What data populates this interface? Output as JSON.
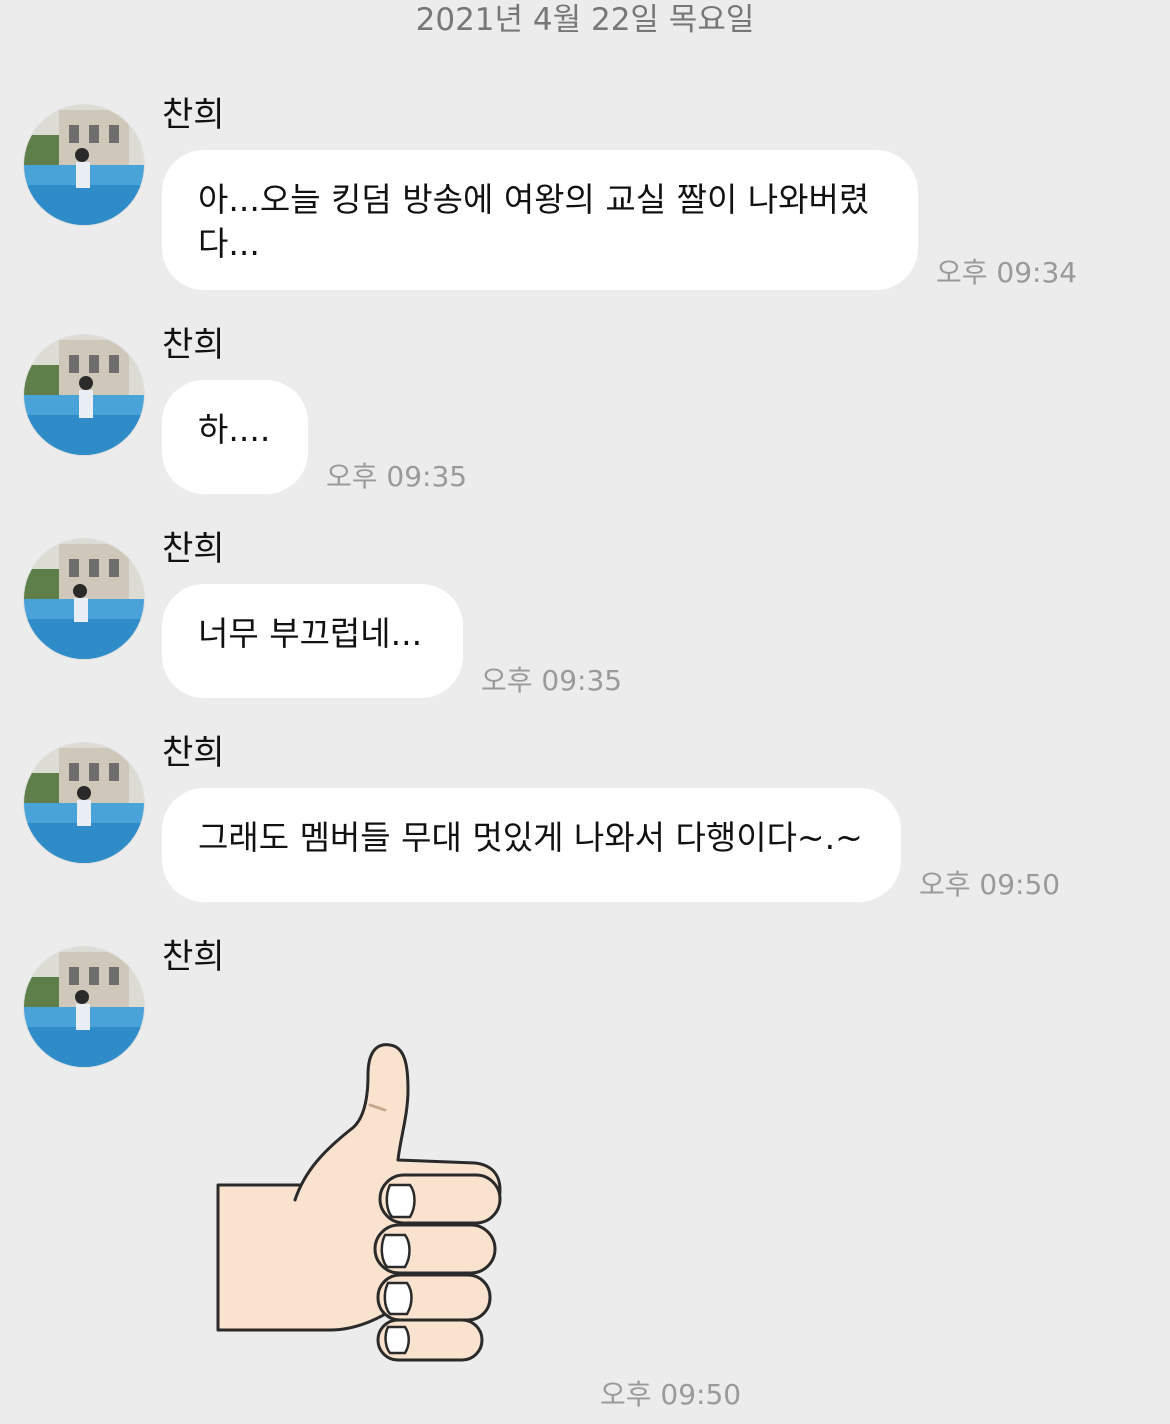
{
  "chat": {
    "date_divider": "2021년 4월 22일 목요일",
    "messages": [
      {
        "sender": "찬희",
        "text": "아...오늘 킹덤 방송에 여왕의 교실 짤이 나와버렸\n다...",
        "time": "오후 09:34"
      },
      {
        "sender": "찬희",
        "text": "하....",
        "time": "오후 09:35"
      },
      {
        "sender": "찬희",
        "text": "너무 부끄럽네...",
        "time": "오후 09:35"
      },
      {
        "sender": "찬희",
        "text": "그래도 멤버들 무대 멋있게 나와서 다행이다~.~",
        "time": "오후 09:50"
      },
      {
        "sender": "찬희",
        "sticker": "thumbs-up-icon",
        "time": "오후 09:50"
      }
    ]
  },
  "colors": {
    "background": "#ececec",
    "bubble": "#ffffff",
    "text": "#111111",
    "timestamp": "#9a9a9a",
    "date": "#777777"
  }
}
